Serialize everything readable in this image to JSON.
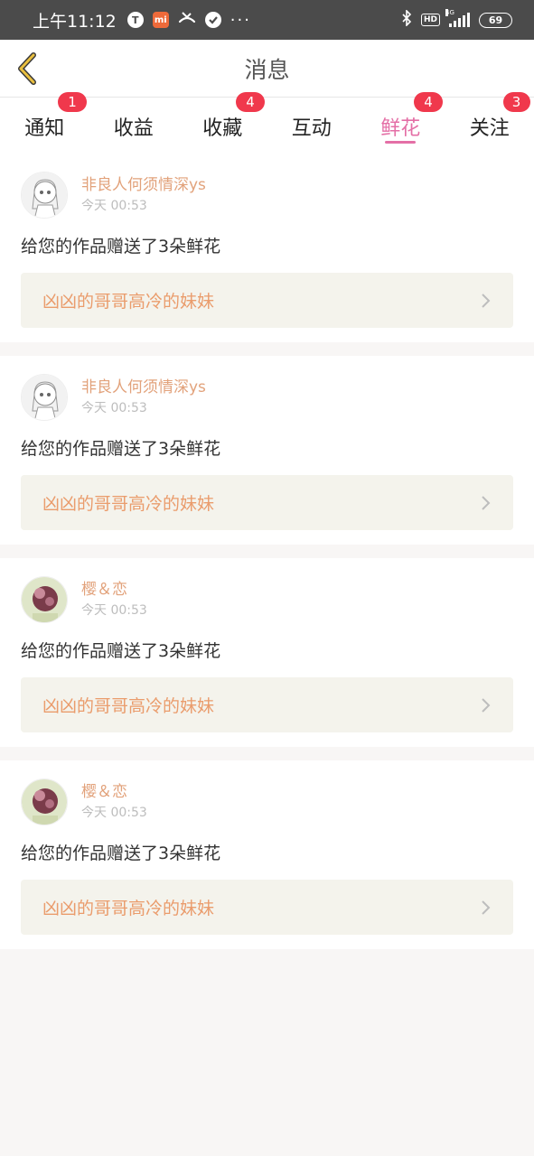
{
  "status_bar": {
    "time": "上午11:12",
    "left_icons": [
      "T",
      "mi",
      "missed-call",
      "check"
    ],
    "more": "···",
    "hd": "HD",
    "network": "4G",
    "battery": "69"
  },
  "header": {
    "title": "消息",
    "back_icon": "chevron-left-icon"
  },
  "tabs": [
    {
      "label": "通知",
      "badge": "1",
      "active": false
    },
    {
      "label": "收益",
      "badge": "",
      "active": false
    },
    {
      "label": "收藏",
      "badge": "4",
      "active": false
    },
    {
      "label": "互动",
      "badge": "",
      "active": false
    },
    {
      "label": "鲜花",
      "badge": "4",
      "active": true
    },
    {
      "label": "关注",
      "badge": "3",
      "active": false
    }
  ],
  "items": [
    {
      "user": "非良人何须情深ys",
      "time": "今天 00:53",
      "message": "给您的作品赠送了3朵鲜花",
      "work": "凶凶的哥哥高冷的妹妹",
      "avatar": "sketch"
    },
    {
      "user": "非良人何须情深ys",
      "time": "今天 00:53",
      "message": "给您的作品赠送了3朵鲜花",
      "work": "凶凶的哥哥高冷的妹妹",
      "avatar": "sketch"
    },
    {
      "user": "樱＆恋",
      "time": "今天 00:53",
      "message": "给您的作品赠送了3朵鲜花",
      "work": "凶凶的哥哥高冷的妹妹",
      "avatar": "photo"
    },
    {
      "user": "樱＆恋",
      "time": "今天 00:53",
      "message": "给您的作品赠送了3朵鲜花",
      "work": "凶凶的哥哥高冷的妹妹",
      "avatar": "photo"
    }
  ],
  "colors": {
    "accent": "#e46fa6",
    "badge": "#f0384c",
    "username": "#e2a27b",
    "work_title": "#ea9c6c",
    "back_arrow": "#e9bf3f"
  }
}
